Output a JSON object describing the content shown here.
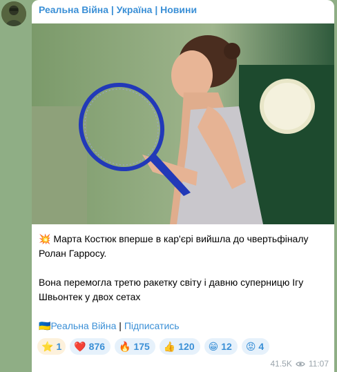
{
  "channel": {
    "name": "Реальна Війна | Україна | Новини"
  },
  "post": {
    "line1_emoji": "💥",
    "line1": "Марта Костюк вперше в кар'єрі вийшла до чвертьфіналу Ролан Гарросу.",
    "line2": "Вона перемогла третю ракетку світу і давню суперницю Ігу Швьонтек у двох сетах",
    "footer_flag": "🇺🇦",
    "footer_link1": "Реальна Війна",
    "footer_sep": "|",
    "footer_link2": "Підписатись"
  },
  "reactions": [
    {
      "emoji": "⭐",
      "count": "1",
      "icon": "star-icon"
    },
    {
      "emoji": "❤️",
      "count": "876",
      "icon": "heart-icon"
    },
    {
      "emoji": "🔥",
      "count": "175",
      "icon": "fire-icon"
    },
    {
      "emoji": "👍",
      "count": "120",
      "icon": "thumbs-up-icon"
    },
    {
      "emoji": "😁",
      "count": "12",
      "icon": "grin-icon"
    },
    {
      "emoji": "😡",
      "count": "4",
      "icon": "angry-icon"
    }
  ],
  "meta": {
    "views": "41.5K",
    "time": "11:07"
  },
  "colors": {
    "link": "#3a8fd6",
    "background": "#8fae85"
  }
}
